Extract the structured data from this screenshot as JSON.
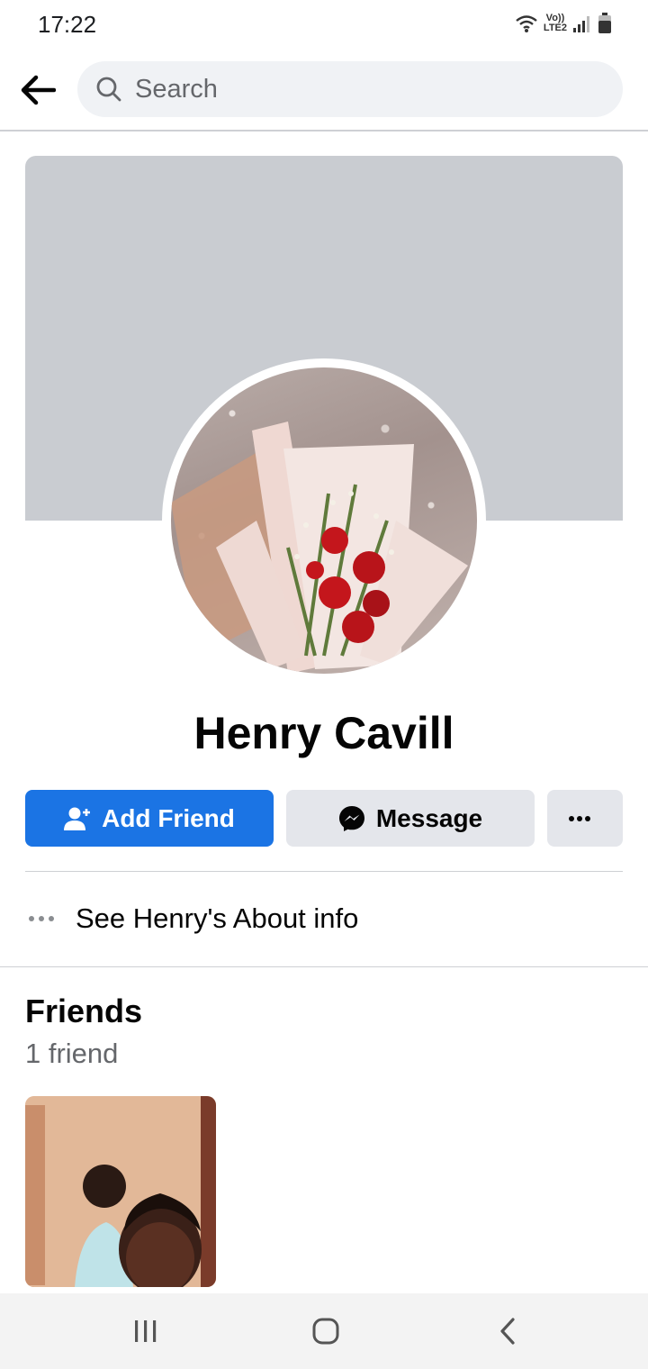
{
  "status_bar": {
    "time": "17:22",
    "icons": [
      "wifi-icon",
      "volte-icon",
      "signal-icon",
      "battery-icon"
    ],
    "volte_top": "Vo))",
    "volte_bottom": "LTE2"
  },
  "top_nav": {
    "back_icon": "arrow-left-icon",
    "search_placeholder": "Search",
    "search_icon": "search-icon"
  },
  "profile": {
    "name": "Henry Cavill",
    "cover_color": "#c9ccd1",
    "avatar_description_icon": "profile-photo"
  },
  "actions": {
    "add_friend_label": "Add Friend",
    "message_label": "Message",
    "more_label": "•••",
    "accent_color": "#1b74e4"
  },
  "about": {
    "label": "See Henry's About info"
  },
  "friends": {
    "title": "Friends",
    "count_label": "1 friend"
  },
  "android_nav": {
    "items": [
      "recent-apps-icon",
      "home-icon",
      "back-icon"
    ]
  }
}
